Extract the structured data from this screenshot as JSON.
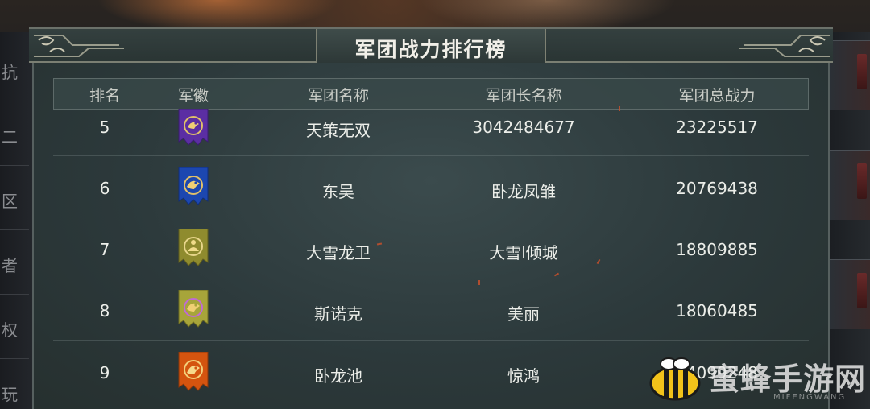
{
  "title": "军团战力排行榜",
  "left_tabs": [
    "抗",
    "二",
    "区",
    "者",
    "权",
    "玩"
  ],
  "columns": {
    "rank": "排名",
    "emblem": "军徽",
    "legion_name": "军团名称",
    "leader_name": "军团长名称",
    "power": "军团总战力"
  },
  "rows": [
    {
      "rank": "5",
      "emblem": "purple-dragon-emblem",
      "emblem_color": "#5b2ea3",
      "legion_name": "天策无双",
      "leader_name": "3042484677",
      "power": "23225517"
    },
    {
      "rank": "6",
      "emblem": "blue-dragon-emblem",
      "emblem_color": "#1c47b0",
      "legion_name": "东吴",
      "leader_name": "卧龙凤雏",
      "power": "20769438"
    },
    {
      "rank": "7",
      "emblem": "olive-buddha-emblem",
      "emblem_color": "#8f8b2e",
      "legion_name": "大雪龙卫",
      "leader_name": "大雪l倾城",
      "power": "18809885"
    },
    {
      "rank": "8",
      "emblem": "olive-tiger-emblem",
      "emblem_color": "#a7a53a",
      "legion_name": "斯诺克",
      "leader_name": "美丽",
      "power": "18060485"
    },
    {
      "rank": "9",
      "emblem": "orange-wolf-emblem",
      "emblem_color": "#d4540f",
      "legion_name": "卧龙池",
      "leader_name": "惊鸿",
      "power": "14099248"
    }
  ],
  "watermark": {
    "text": "蜜蜂手游网",
    "sub": "MIFENGWANG",
    "icon": "bee-icon"
  }
}
